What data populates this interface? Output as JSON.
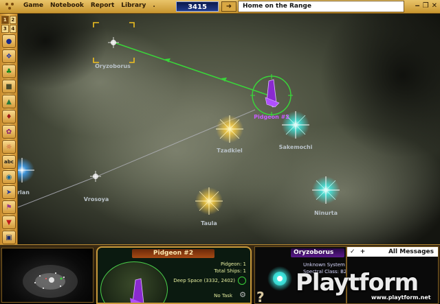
{
  "menubar": {
    "items": [
      "Game",
      "Notebook",
      "Report",
      "Library",
      "."
    ],
    "turn": "3415",
    "location_title": "Home on the Range",
    "window_buttons": [
      "‒",
      "❐",
      "✕"
    ]
  },
  "toolbar": {
    "view_numbers": [
      "1",
      "2",
      "3",
      "4"
    ],
    "tools": [
      "bomb-icon",
      "ships-icon",
      "planet-tree-icon",
      "factory-icon",
      "chart-icon",
      "shield-icon",
      "dna-icon",
      "rainbow-icon",
      "abc-icon",
      "globe-icon",
      "fleet-icon",
      "flag-icon",
      "hammer-icon",
      "book-icon"
    ],
    "abc_label": "abc"
  },
  "map": {
    "stars": [
      {
        "name": "Oryzoborus",
        "color": "#c8c8c8",
        "kind": "small"
      },
      {
        "name": "Pidgeon #2",
        "color": "#c85cff",
        "kind": "ship"
      },
      {
        "name": "Tzadkiel",
        "color": "#ffe066",
        "kind": "big"
      },
      {
        "name": "Sakemochi",
        "color": "#4fe8e0",
        "kind": "big"
      },
      {
        "name": "rlan",
        "color": "#4fb8ff",
        "kind": "big"
      },
      {
        "name": "Vrosoya",
        "color": "#c8c8c8",
        "kind": "small"
      },
      {
        "name": "Taula",
        "color": "#ffc040",
        "kind": "big"
      },
      {
        "name": "Ninurta",
        "color": "#4fe8d8",
        "kind": "big"
      }
    ],
    "route_color": "#3ad43a",
    "lane_color": "#c8c8d8"
  },
  "ship_panel": {
    "title": "Pidgeon #2",
    "pidgeon_count": "Pidgeon: 1",
    "total_ships": "Total Ships: 1",
    "location": "Deep Space (3332, 2402)",
    "task": "No Task"
  },
  "system_panel": {
    "title": "Oryzoborus",
    "line1": "Unknown System",
    "line2": "Spectral Class: B2"
  },
  "messages_panel": {
    "title": "All Messages"
  },
  "watermark": {
    "brand": "Playtform",
    "url": "www.playtform.net"
  }
}
